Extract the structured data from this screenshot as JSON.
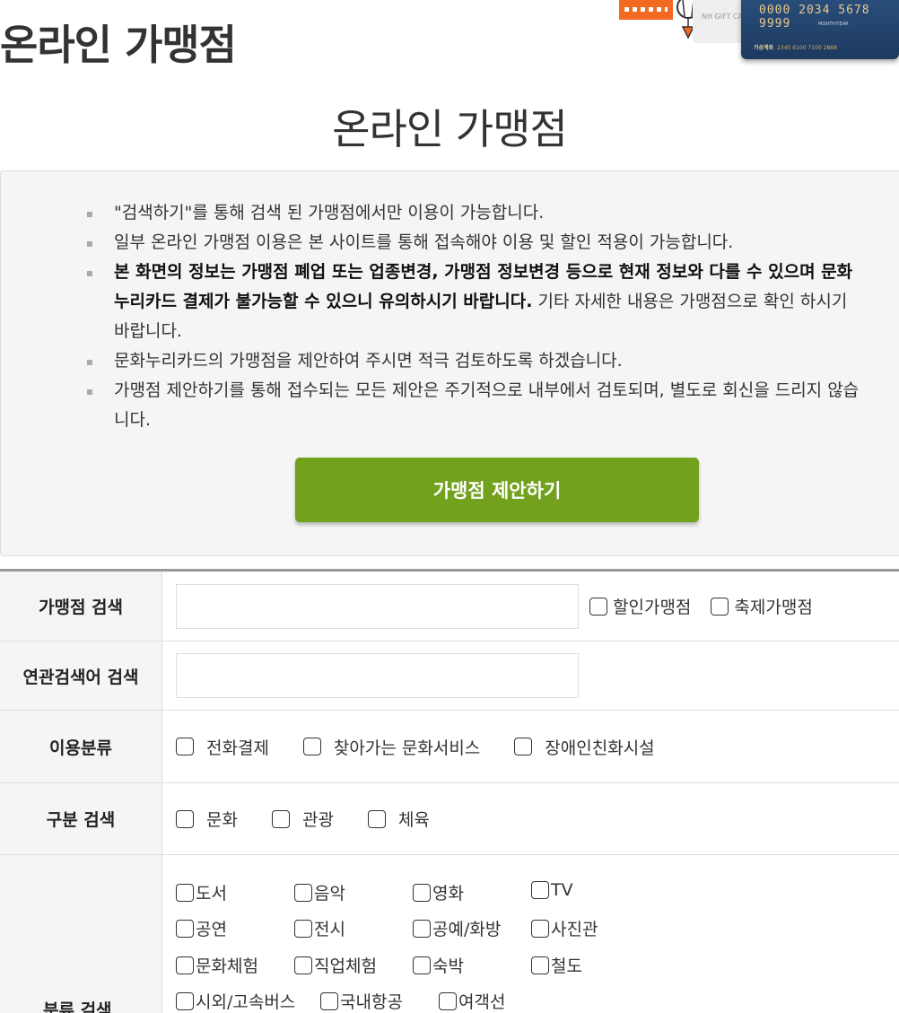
{
  "header": {
    "title": "온라인 가맹점",
    "banner": {
      "card_number": "0000 2034 5678 9999",
      "card_sub": "MONTH/YEAR",
      "card_label": "가상계좌",
      "card_account": "2345 6100 7100 2888",
      "gift_card_text": "NH GIFT CA"
    }
  },
  "section_title": "온라인 가맹점",
  "notice": {
    "items": [
      {
        "text": "\"검색하기\"를 통해 검색 된 가맹점에서만 이용이 가능합니다."
      },
      {
        "text": "일부 온라인 가맹점 이용은 본 사이트를 통해 접속해야 이용 및 할인 적용이 가능합니다."
      },
      {
        "bold": "본 화면의 정보는 가맹점 폐업 또는 업종변경, 가맹점 정보변경 등으로 현재 정보와 다를 수 있으며 문화누리카드 결제가 불가능할 수 있으니 유의하시기 바랍니다.",
        "text": " 기타 자세한 내용은 가맹점으로 확인 하시기 바랍니다."
      },
      {
        "text": "문화누리카드의 가맹점을 제안하여 주시면 적극 검토하도록 하겠습니다."
      },
      {
        "text": "가맹점 제안하기를 통해 접수되는 모든 제안은 주기적으로 내부에서 검토되며, 별도로 회신을 드리지 않습니다."
      }
    ],
    "suggest_button": "가맹점 제안하기"
  },
  "search": {
    "store_label": "가맹점 검색",
    "store_value": "",
    "discount_label": "할인가맹점",
    "festival_label": "축제가맹점",
    "related_label": "연관검색어 검색",
    "related_value": "",
    "usage_label": "이용분류",
    "usage_options": [
      "전화결제",
      "찾아가는 문화서비스",
      "장애인친화시설"
    ],
    "division_label": "구분 검색",
    "division_options": [
      "문화",
      "관광",
      "체육"
    ],
    "category_label": "분류 검색",
    "category_options": [
      "도서",
      "음악",
      "영화",
      "TV",
      "공연",
      "전시",
      "공예/화방",
      "사진관",
      "문화체험",
      "직업체험",
      "숙박",
      "철도",
      "시외/고속버스",
      "국내항공",
      "여객선"
    ]
  },
  "colors": {
    "button_green": "#72a11e",
    "panel_bg": "#f5f5f5",
    "border": "#dddddd"
  }
}
